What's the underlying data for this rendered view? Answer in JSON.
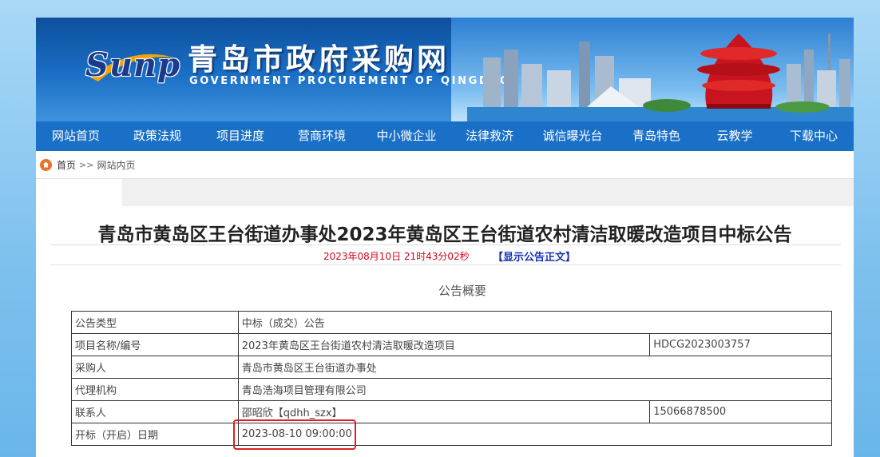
{
  "header": {
    "logo": "Sunp",
    "title": "青岛市政府采购网",
    "subtitle": "GOVERNMENT PROCUREMENT OF QINGDAO"
  },
  "nav": {
    "items": [
      "网站首页",
      "政策法规",
      "项目进度",
      "营商环境",
      "中小微企业",
      "法律救济",
      "诚信曝光台",
      "青岛特色",
      "云教学",
      "下载中心"
    ]
  },
  "breadcrumb": {
    "home": "首页",
    "separator": ">>",
    "current": "网站内页"
  },
  "article": {
    "title": "青岛市黄岛区王台街道办事处2023年黄岛区王台街道农村清洁取暖改造项目中标公告",
    "date": "2023年08月10日 21时43分02秒",
    "show_link": "【显示公告正文】",
    "summary_heading": "公告概要"
  },
  "table": {
    "rows": [
      {
        "label": "公告类型",
        "value": "中标（成交）公告",
        "extra": ""
      },
      {
        "label": "项目名称/编号",
        "value": "2023年黄岛区王台街道农村清洁取暖改造项目",
        "extra": "HDCG2023003757"
      },
      {
        "label": "采购人",
        "value": "青岛市黄岛区王台街道办事处",
        "extra": ""
      },
      {
        "label": "代理机构",
        "value": "青岛浩海项目管理有限公司",
        "extra": ""
      },
      {
        "label": "联系人",
        "value": "邵昭欣【qdhh_szx】",
        "extra": "15066878500"
      },
      {
        "label": "开标（开启）日期",
        "value": "2023-08-10 09:00:00",
        "extra": ""
      }
    ]
  },
  "colors": {
    "nav_bg": "#1a6fc6",
    "date_red": "#d0021b",
    "link_blue": "#1530b5",
    "highlight": "#e02020"
  }
}
